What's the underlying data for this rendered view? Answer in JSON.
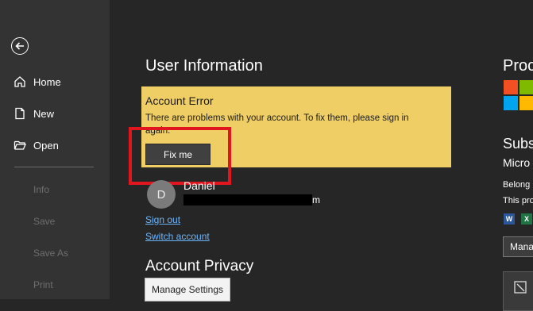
{
  "sidebar": {
    "home": "Home",
    "new": "New",
    "open": "Open",
    "info": "Info",
    "save": "Save",
    "save_as": "Save As",
    "print": "Print"
  },
  "main": {
    "user_info_title": "User Information",
    "banner": {
      "title": "Account Error",
      "message": "There are problems with your account. To fix them, please sign in again.",
      "fix_button": "Fix me"
    },
    "user": {
      "initial": "D",
      "name": "Daniel",
      "email_tail": "m"
    },
    "sign_out": "Sign out",
    "switch_account": "Switch account",
    "privacy_title": "Account Privacy",
    "manage_settings": "Manage Settings"
  },
  "right": {
    "product_title": "Proc",
    "subscription_title": "Subs",
    "product_name": "Micro",
    "belongs": "Belong",
    "this_product": "This pro",
    "manage_button": "Mana"
  },
  "colors": {
    "banner": "#efcf65",
    "highlight": "#e0151d",
    "link": "#6cb6ff"
  }
}
